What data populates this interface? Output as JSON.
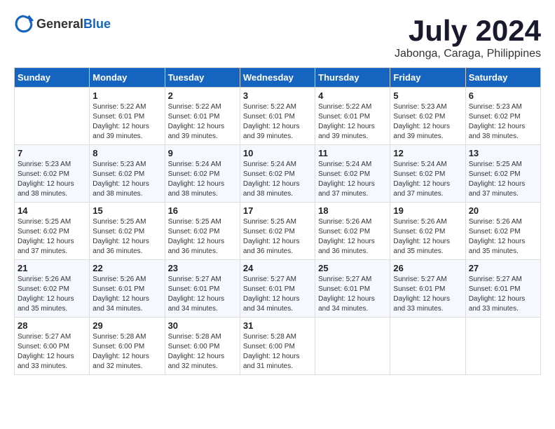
{
  "header": {
    "logo_general": "General",
    "logo_blue": "Blue",
    "month_year": "July 2024",
    "location": "Jabonga, Caraga, Philippines"
  },
  "weekdays": [
    "Sunday",
    "Monday",
    "Tuesday",
    "Wednesday",
    "Thursday",
    "Friday",
    "Saturday"
  ],
  "weeks": [
    [
      {
        "day": "",
        "sunrise": "",
        "sunset": "",
        "daylight": ""
      },
      {
        "day": "1",
        "sunrise": "Sunrise: 5:22 AM",
        "sunset": "Sunset: 6:01 PM",
        "daylight": "Daylight: 12 hours and 39 minutes."
      },
      {
        "day": "2",
        "sunrise": "Sunrise: 5:22 AM",
        "sunset": "Sunset: 6:01 PM",
        "daylight": "Daylight: 12 hours and 39 minutes."
      },
      {
        "day": "3",
        "sunrise": "Sunrise: 5:22 AM",
        "sunset": "Sunset: 6:01 PM",
        "daylight": "Daylight: 12 hours and 39 minutes."
      },
      {
        "day": "4",
        "sunrise": "Sunrise: 5:22 AM",
        "sunset": "Sunset: 6:01 PM",
        "daylight": "Daylight: 12 hours and 39 minutes."
      },
      {
        "day": "5",
        "sunrise": "Sunrise: 5:23 AM",
        "sunset": "Sunset: 6:02 PM",
        "daylight": "Daylight: 12 hours and 39 minutes."
      },
      {
        "day": "6",
        "sunrise": "Sunrise: 5:23 AM",
        "sunset": "Sunset: 6:02 PM",
        "daylight": "Daylight: 12 hours and 38 minutes."
      }
    ],
    [
      {
        "day": "7",
        "sunrise": "Sunrise: 5:23 AM",
        "sunset": "Sunset: 6:02 PM",
        "daylight": "Daylight: 12 hours and 38 minutes."
      },
      {
        "day": "8",
        "sunrise": "Sunrise: 5:23 AM",
        "sunset": "Sunset: 6:02 PM",
        "daylight": "Daylight: 12 hours and 38 minutes."
      },
      {
        "day": "9",
        "sunrise": "Sunrise: 5:24 AM",
        "sunset": "Sunset: 6:02 PM",
        "daylight": "Daylight: 12 hours and 38 minutes."
      },
      {
        "day": "10",
        "sunrise": "Sunrise: 5:24 AM",
        "sunset": "Sunset: 6:02 PM",
        "daylight": "Daylight: 12 hours and 38 minutes."
      },
      {
        "day": "11",
        "sunrise": "Sunrise: 5:24 AM",
        "sunset": "Sunset: 6:02 PM",
        "daylight": "Daylight: 12 hours and 37 minutes."
      },
      {
        "day": "12",
        "sunrise": "Sunrise: 5:24 AM",
        "sunset": "Sunset: 6:02 PM",
        "daylight": "Daylight: 12 hours and 37 minutes."
      },
      {
        "day": "13",
        "sunrise": "Sunrise: 5:25 AM",
        "sunset": "Sunset: 6:02 PM",
        "daylight": "Daylight: 12 hours and 37 minutes."
      }
    ],
    [
      {
        "day": "14",
        "sunrise": "Sunrise: 5:25 AM",
        "sunset": "Sunset: 6:02 PM",
        "daylight": "Daylight: 12 hours and 37 minutes."
      },
      {
        "day": "15",
        "sunrise": "Sunrise: 5:25 AM",
        "sunset": "Sunset: 6:02 PM",
        "daylight": "Daylight: 12 hours and 36 minutes."
      },
      {
        "day": "16",
        "sunrise": "Sunrise: 5:25 AM",
        "sunset": "Sunset: 6:02 PM",
        "daylight": "Daylight: 12 hours and 36 minutes."
      },
      {
        "day": "17",
        "sunrise": "Sunrise: 5:25 AM",
        "sunset": "Sunset: 6:02 PM",
        "daylight": "Daylight: 12 hours and 36 minutes."
      },
      {
        "day": "18",
        "sunrise": "Sunrise: 5:26 AM",
        "sunset": "Sunset: 6:02 PM",
        "daylight": "Daylight: 12 hours and 36 minutes."
      },
      {
        "day": "19",
        "sunrise": "Sunrise: 5:26 AM",
        "sunset": "Sunset: 6:02 PM",
        "daylight": "Daylight: 12 hours and 35 minutes."
      },
      {
        "day": "20",
        "sunrise": "Sunrise: 5:26 AM",
        "sunset": "Sunset: 6:02 PM",
        "daylight": "Daylight: 12 hours and 35 minutes."
      }
    ],
    [
      {
        "day": "21",
        "sunrise": "Sunrise: 5:26 AM",
        "sunset": "Sunset: 6:02 PM",
        "daylight": "Daylight: 12 hours and 35 minutes."
      },
      {
        "day": "22",
        "sunrise": "Sunrise: 5:26 AM",
        "sunset": "Sunset: 6:01 PM",
        "daylight": "Daylight: 12 hours and 34 minutes."
      },
      {
        "day": "23",
        "sunrise": "Sunrise: 5:27 AM",
        "sunset": "Sunset: 6:01 PM",
        "daylight": "Daylight: 12 hours and 34 minutes."
      },
      {
        "day": "24",
        "sunrise": "Sunrise: 5:27 AM",
        "sunset": "Sunset: 6:01 PM",
        "daylight": "Daylight: 12 hours and 34 minutes."
      },
      {
        "day": "25",
        "sunrise": "Sunrise: 5:27 AM",
        "sunset": "Sunset: 6:01 PM",
        "daylight": "Daylight: 12 hours and 34 minutes."
      },
      {
        "day": "26",
        "sunrise": "Sunrise: 5:27 AM",
        "sunset": "Sunset: 6:01 PM",
        "daylight": "Daylight: 12 hours and 33 minutes."
      },
      {
        "day": "27",
        "sunrise": "Sunrise: 5:27 AM",
        "sunset": "Sunset: 6:01 PM",
        "daylight": "Daylight: 12 hours and 33 minutes."
      }
    ],
    [
      {
        "day": "28",
        "sunrise": "Sunrise: 5:27 AM",
        "sunset": "Sunset: 6:00 PM",
        "daylight": "Daylight: 12 hours and 33 minutes."
      },
      {
        "day": "29",
        "sunrise": "Sunrise: 5:28 AM",
        "sunset": "Sunset: 6:00 PM",
        "daylight": "Daylight: 12 hours and 32 minutes."
      },
      {
        "day": "30",
        "sunrise": "Sunrise: 5:28 AM",
        "sunset": "Sunset: 6:00 PM",
        "daylight": "Daylight: 12 hours and 32 minutes."
      },
      {
        "day": "31",
        "sunrise": "Sunrise: 5:28 AM",
        "sunset": "Sunset: 6:00 PM",
        "daylight": "Daylight: 12 hours and 31 minutes."
      },
      {
        "day": "",
        "sunrise": "",
        "sunset": "",
        "daylight": ""
      },
      {
        "day": "",
        "sunrise": "",
        "sunset": "",
        "daylight": ""
      },
      {
        "day": "",
        "sunrise": "",
        "sunset": "",
        "daylight": ""
      }
    ]
  ]
}
